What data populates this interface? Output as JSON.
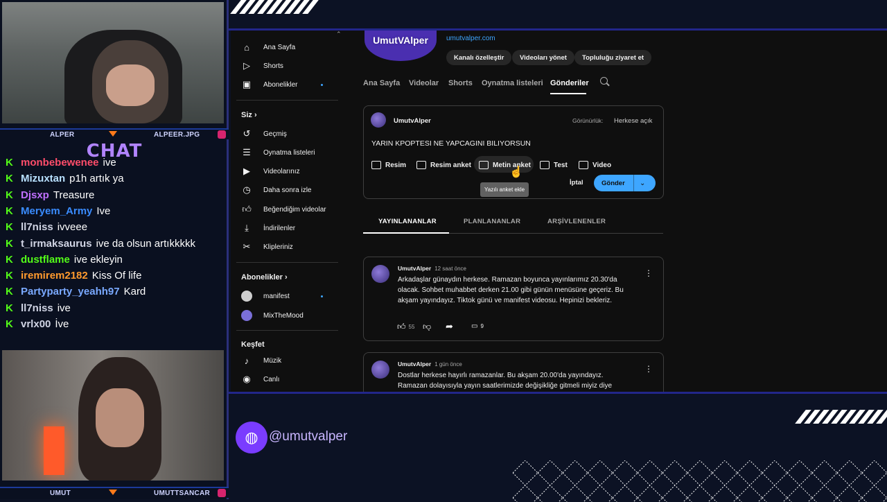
{
  "stream": {
    "cam_top_name_left": "ALPER",
    "cam_top_name_right": "ALPEER.JPG",
    "cam_bottom_name_left": "UMUT",
    "cam_bottom_name_right": "UMUTTSANCAR",
    "chat_title": "CHAT",
    "handle": "@umutvalper",
    "chat": [
      {
        "user": "monbebewenee",
        "text": "ive",
        "color": "#ff4d6a"
      },
      {
        "user": "Mizuxtan",
        "text": "p1h artık ya",
        "color": "#b8e0ff"
      },
      {
        "user": "Djsxp",
        "text": "Treasure",
        "color": "#c070ff"
      },
      {
        "user": "Meryem_Army",
        "text": "Ive",
        "color": "#3a8cff"
      },
      {
        "user": "ll7niss",
        "text": "ivveee",
        "color": "#d0d4e4"
      },
      {
        "user": "t_irmaksaurus",
        "text": "ive da olsun artıkkkkk",
        "color": "#d0d4e4"
      },
      {
        "user": "dustflame",
        "text": "ive ekleyin",
        "color": "#53fc18"
      },
      {
        "user": "iremirem2182",
        "text": "Kiss Of life",
        "color": "#ff9a2e"
      },
      {
        "user": "Partyparty_yeahh97",
        "text": "Kard",
        "color": "#7aa9ff"
      },
      {
        "user": "ll7niss",
        "text": "ive",
        "color": "#d0d4e4"
      },
      {
        "user": "vrlx00",
        "text": "İve",
        "color": "#d0d4e4"
      }
    ]
  },
  "sidebar": {
    "items_top": [
      "Ana Sayfa",
      "Shorts",
      "Abonelikler"
    ],
    "siz_header": "Siz",
    "items_you": [
      "Geçmiş",
      "Oynatma listeleri",
      "Videolarınız",
      "Daha sonra izle",
      "Beğendiğim videolar",
      "İndirilenler",
      "Klipleriniz"
    ],
    "subs_header": "Abonelikler",
    "subs": [
      "manifest",
      "MixTheMood"
    ],
    "explore_header": "Keşfet",
    "explore": [
      "Müzik",
      "Canlı"
    ]
  },
  "channel": {
    "logo_text": "UmutVAlper",
    "link": "umutvalper.com",
    "buttons": [
      "Kanalı özelleştir",
      "Videoları yönet",
      "Topluluğu ziyaret et"
    ],
    "tabs": [
      "Ana Sayfa",
      "Videolar",
      "Shorts",
      "Oynatma listeleri",
      "Gönderiler"
    ],
    "active_tab": "Gönderiler"
  },
  "composer": {
    "author": "UmutvAlper",
    "visibility_label": "Görünürlük:",
    "visibility_value": "Herkese açık",
    "text": "YARIN KPOPTESI NE YAPCAGINI BILIYORSUN",
    "actions": [
      "Resim",
      "Resim anket",
      "Metin anket",
      "Test",
      "Video"
    ],
    "tooltip": "Yazılı anket ekle",
    "cancel": "İptal",
    "submit": "Gönder"
  },
  "post_tabs": [
    "YAYINLANANLAR",
    "PLANLANANLAR",
    "ARŞİVLENENLER"
  ],
  "posts": [
    {
      "author": "UmutvAlper",
      "time": "12 saat önce",
      "text": "Arkadaşlar günaydın herkese. Ramazan boyunca yayınlarımız 20.30'da olacak. Sohbet muhabbet derken 21.00 gibi günün menüsüne geçeriz. Bu akşam yayındayız. Tiktok günü ve manifest videosu. Hepinizi bekleriz.",
      "likes": "55",
      "comments": "9"
    },
    {
      "author": "UmutvAlper",
      "time": "1 gün önce",
      "text": "Dostlar herkese hayırlı ramazanlar. Bu akşam 20.00'da yayındayız. Ramazan dolayısıyla yayın saatlerimizde değişikliğe gitmeli miyiz diye"
    }
  ]
}
